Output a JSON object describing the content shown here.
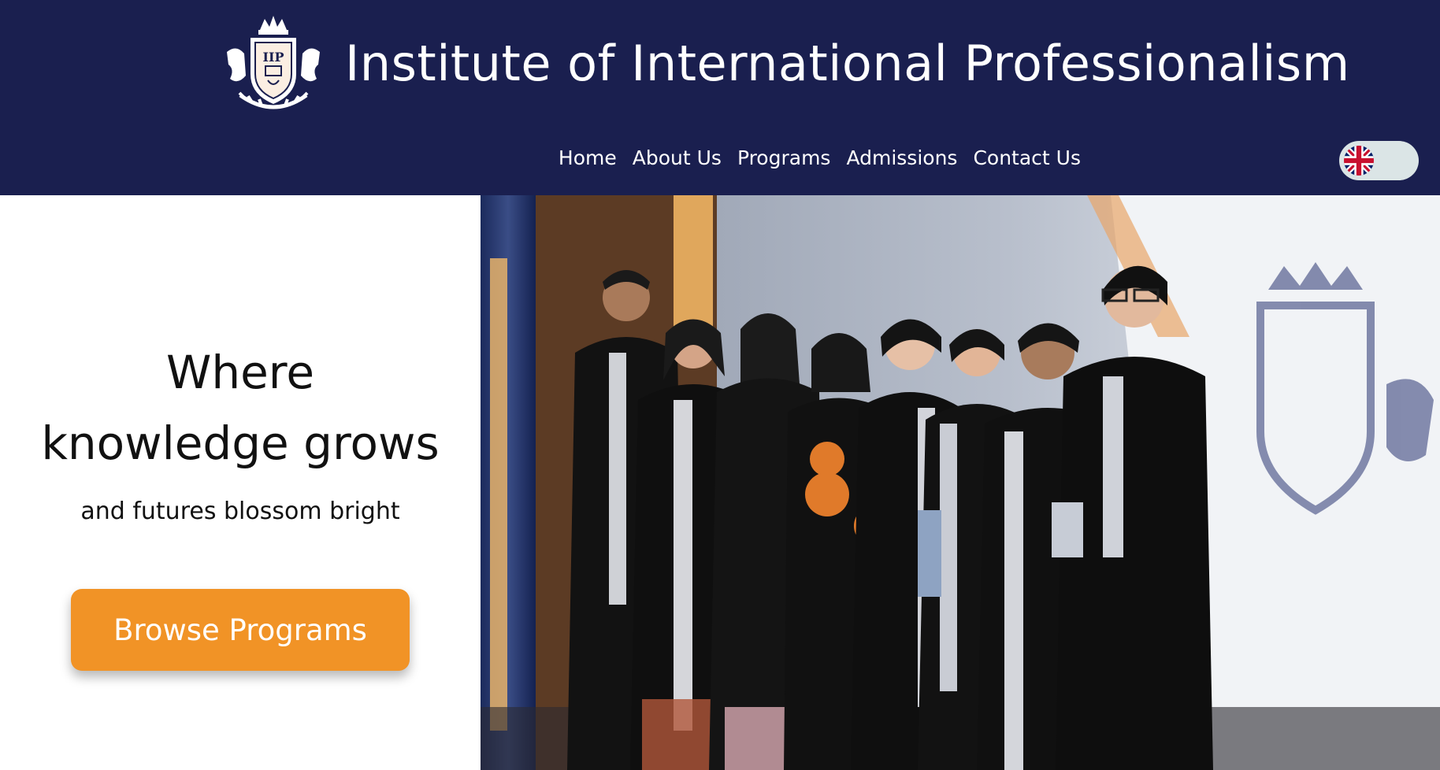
{
  "site": {
    "title": "Institute of International Professionalism",
    "logo_text": "IIP"
  },
  "nav": {
    "items": [
      {
        "label": "Home"
      },
      {
        "label": "About Us"
      },
      {
        "label": "Programs"
      },
      {
        "label": "Admissions"
      },
      {
        "label": "Contact Us"
      }
    ],
    "language": {
      "flag_icon": "uk-flag-icon"
    }
  },
  "hero": {
    "headline_line1": "Where",
    "headline_line2": "knowledge grows",
    "subheadline": "and futures blossom bright",
    "cta_label": "Browse Programs"
  },
  "colors": {
    "header_bg": "#1a1f4f",
    "cta_bg": "#f19326",
    "toggle_bg": "#dbe5e6"
  }
}
